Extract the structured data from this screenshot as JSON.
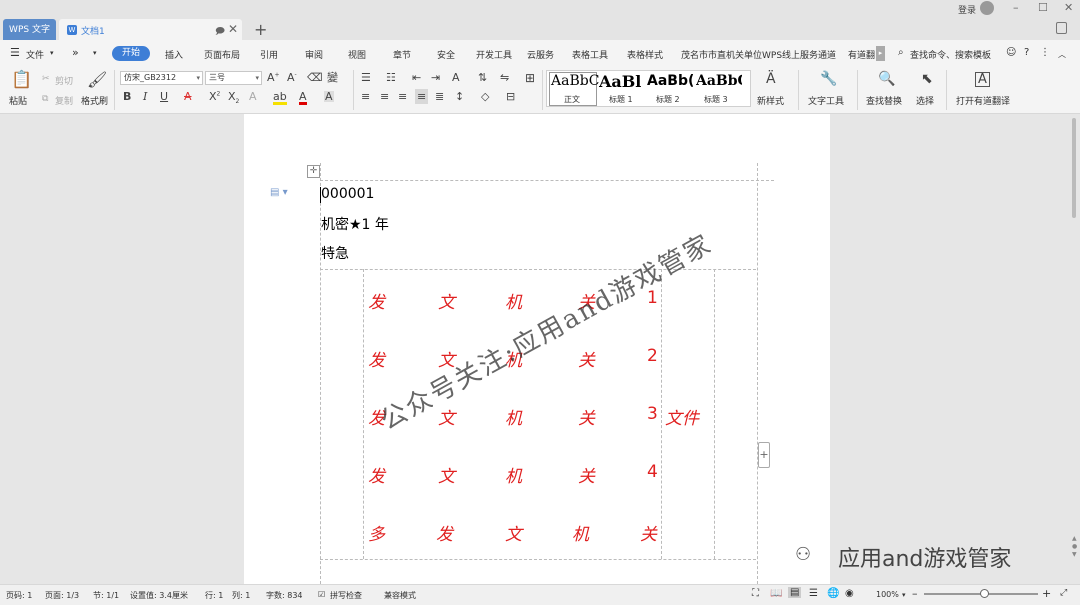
{
  "titlebar": {
    "app_tab": "WPS 文字",
    "doc_tab": "文档1",
    "doc_icon": "W",
    "new_tab": "+",
    "login": "登录",
    "minimize": "–",
    "restore": "☐",
    "close": "✕",
    "tab_pin": "🗩",
    "tab_close": "✕"
  },
  "menubar": {
    "file": "文件",
    "more": "»",
    "active": "开始",
    "items": [
      "插入",
      "页面布局",
      "引用",
      "审阅",
      "视图",
      "章节",
      "安全",
      "开发工具",
      "云服务",
      "表格工具",
      "表格样式",
      "茂名市市直机关单位WPS线上服务通道",
      "有道翻"
    ],
    "search": "查找命令、搜索模板"
  },
  "ribbon": {
    "paste": "粘贴",
    "cut": "剪切",
    "copy": "复制",
    "format_painter": "格式刷",
    "font_name": "仿宋_GB2312",
    "font_size": "三号",
    "styles": [
      {
        "preview": "AaBbC",
        "label": "正文"
      },
      {
        "preview": "AaBl",
        "label": "标题 1"
      },
      {
        "preview": "AaBb(",
        "label": "标题 2"
      },
      {
        "preview": "AaBbC",
        "label": "标题 3"
      }
    ],
    "new_style": "新样式",
    "text_tools": "文字工具",
    "find_replace": "查找替换",
    "select": "选择",
    "translate": "打开有道翻译"
  },
  "document": {
    "line1": "000001",
    "line2": "机密★1 年",
    "line3": "特急",
    "rows": [
      {
        "chars": [
          "发",
          "文",
          "机",
          "关"
        ],
        "num": "1",
        "suffix": ""
      },
      {
        "chars": [
          "发",
          "文",
          "机",
          "关"
        ],
        "num": "2",
        "suffix": ""
      },
      {
        "chars": [
          "发",
          "文",
          "机",
          "关"
        ],
        "num": "3",
        "suffix": "文件"
      },
      {
        "chars": [
          "发",
          "文",
          "机",
          "关"
        ],
        "num": "4",
        "suffix": ""
      },
      {
        "chars": [
          "多",
          "发",
          "文",
          "机",
          "关"
        ],
        "num": "",
        "suffix": ""
      }
    ],
    "watermark": "公众号关注:应用and游戏管家",
    "wechat_brand": "应用and游戏管家"
  },
  "statusbar": {
    "page_no": "页码: 1",
    "pages": "页面: 1/3",
    "section": "节: 1/1",
    "setting": "设置值: 3.4厘米",
    "row": "行: 1",
    "col": "列: 1",
    "words": "字数: 834",
    "spell": "拼写检查",
    "compat": "兼容模式",
    "zoom": "100%",
    "zoom_out": "–",
    "zoom_in": "+"
  },
  "colors": {
    "accent": "#3d7ed6",
    "red_text": "#e02020"
  }
}
